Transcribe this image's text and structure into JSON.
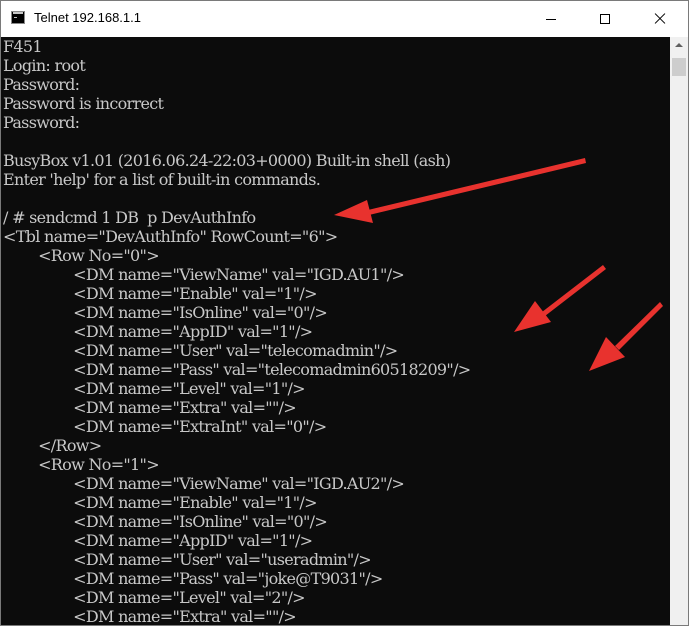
{
  "window": {
    "title": "Telnet 192.168.1.1",
    "icon": "console-icon"
  },
  "controls": {
    "minimize": "minimize-icon",
    "maximize": "maximize-icon",
    "close": "close-icon"
  },
  "terminal": {
    "lines": [
      "F451",
      "Login: root",
      "Password:",
      "Password is incorrect",
      "Password:",
      "",
      "BusyBox v1.01 (2016.06.24-22:03+0000) Built-in shell (ash)",
      "Enter 'help' for a list of built-in commands.",
      "",
      "/ # sendcmd 1 DB  p DevAuthInfo",
      "<Tbl name=\"DevAuthInfo\" RowCount=\"6\">",
      "        <Row No=\"0\">",
      "                <DM name=\"ViewName\" val=\"IGD.AU1\"/>",
      "                <DM name=\"Enable\" val=\"1\"/>",
      "                <DM name=\"IsOnline\" val=\"0\"/>",
      "                <DM name=\"AppID\" val=\"1\"/>",
      "                <DM name=\"User\" val=\"telecomadmin\"/>",
      "                <DM name=\"Pass\" val=\"telecomadmin60518209\"/>",
      "                <DM name=\"Level\" val=\"1\"/>",
      "                <DM name=\"Extra\" val=\"\"/>",
      "                <DM name=\"ExtraInt\" val=\"0\"/>",
      "        </Row>",
      "        <Row No=\"1\">",
      "                <DM name=\"ViewName\" val=\"IGD.AU2\"/>",
      "                <DM name=\"Enable\" val=\"1\"/>",
      "                <DM name=\"IsOnline\" val=\"0\"/>",
      "                <DM name=\"AppID\" val=\"1\"/>",
      "                <DM name=\"User\" val=\"useradmin\"/>",
      "                <DM name=\"Pass\" val=\"joke@T9031\"/>",
      "                <DM name=\"Level\" val=\"2\"/>",
      "                <DM name=\"Extra\" val=\"\"/>"
    ]
  },
  "annotations": {
    "arrow_color": "#e8322e"
  },
  "scrollbar": {
    "up": "scroll-up-icon"
  }
}
